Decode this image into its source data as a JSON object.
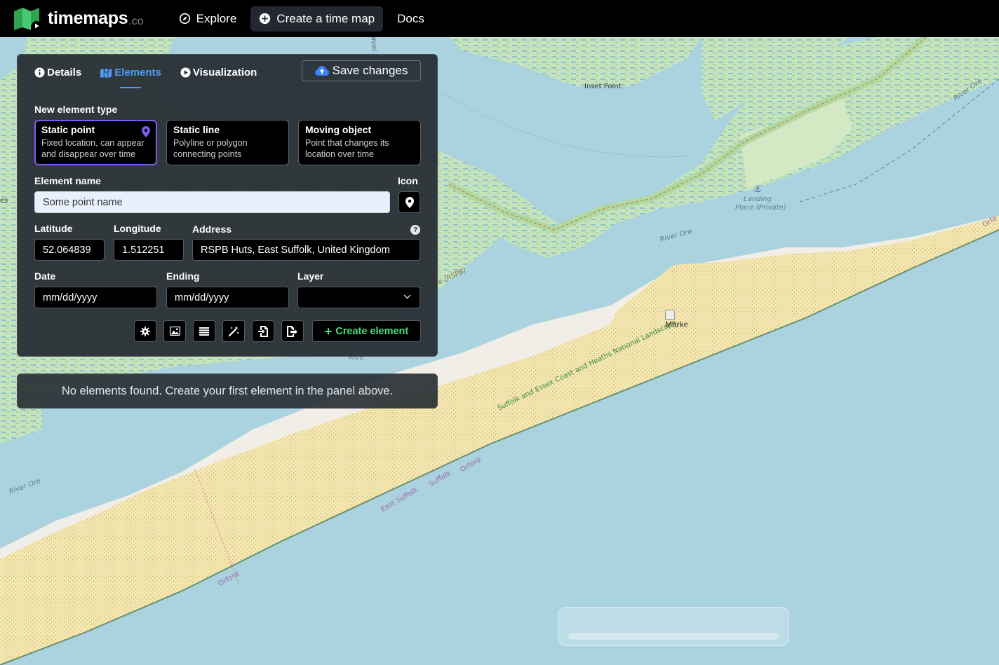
{
  "navbar": {
    "brand_name": "timemaps",
    "brand_tld": ".co",
    "explore_label": "Explore",
    "create_label": "Create a time map",
    "docs_label": "Docs"
  },
  "panel": {
    "tabs": [
      {
        "label": "Details",
        "icon": "info-icon"
      },
      {
        "label": "Elements",
        "icon": "map-icon",
        "active": true
      },
      {
        "label": "Visualization",
        "icon": "play-icon"
      }
    ],
    "save_label": "Save changes",
    "new_type_label": "New element type",
    "types": [
      {
        "title": "Static point",
        "desc_line1": "Fixed location, can appear",
        "desc_line2": "and disappear over time",
        "selected": true
      },
      {
        "title": "Static line",
        "desc_line1": "Polyline or polygon",
        "desc_line2": "connecting points"
      },
      {
        "title": "Moving object",
        "desc_line1": "Point that changes its",
        "desc_line2": "location over time"
      }
    ],
    "element_name_label": "Element name",
    "element_name_placeholder": "Some point name",
    "icon_label": "Icon",
    "latitude_label": "Latitude",
    "latitude_value": "52.064839",
    "longitude_label": "Longitude",
    "longitude_value": "1.512251",
    "address_label": "Address",
    "address_value": "RSPB Huts, East Suffolk, United Kingdom",
    "help_glyph": "?",
    "date_label": "Date",
    "date_value": "mm/dd/yyyy",
    "ending_label": "Ending",
    "ending_value": "mm/dd/yyyy",
    "layer_label": "Layer",
    "layer_value": "",
    "tools": [
      "gear-icon",
      "image-icon",
      "list-icon",
      "magic-wand-icon",
      "file-import-icon",
      "file-export-icon"
    ],
    "create_label": "Create element"
  },
  "empty_message": "No elements found. Create your first element in the panel above.",
  "map": {
    "labels": {
      "inset_point": "Inset Point",
      "river_ore_1": "River Ore",
      "river_ore_2": "River Ore",
      "river_ore_3": "River Ore",
      "landing_1": "Landing",
      "landing_2": "Place (Private)",
      "rspb": "e (RSPB)",
      "river_partial": "Rive",
      "gravel": "ravel",
      "orford_1": "Orford",
      "orford_2": "Orford",
      "orford_3": "Orfo",
      "suffolk": "Suffolk",
      "east_suffolk": "East Suffolk",
      "nl": "Suffolk and Essex Coast and Heaths National Landscape",
      "es_left": "es",
      "marker_alt": "Marke"
    }
  },
  "colors": {
    "navbar_bg": "#000000",
    "accent_blue": "#4d9cf5",
    "selected_border": "#7c5cf5",
    "create_green": "#4ade80",
    "water": "#aad3df",
    "marsh": "#cde8c5",
    "sand": "#f5e9b3"
  }
}
